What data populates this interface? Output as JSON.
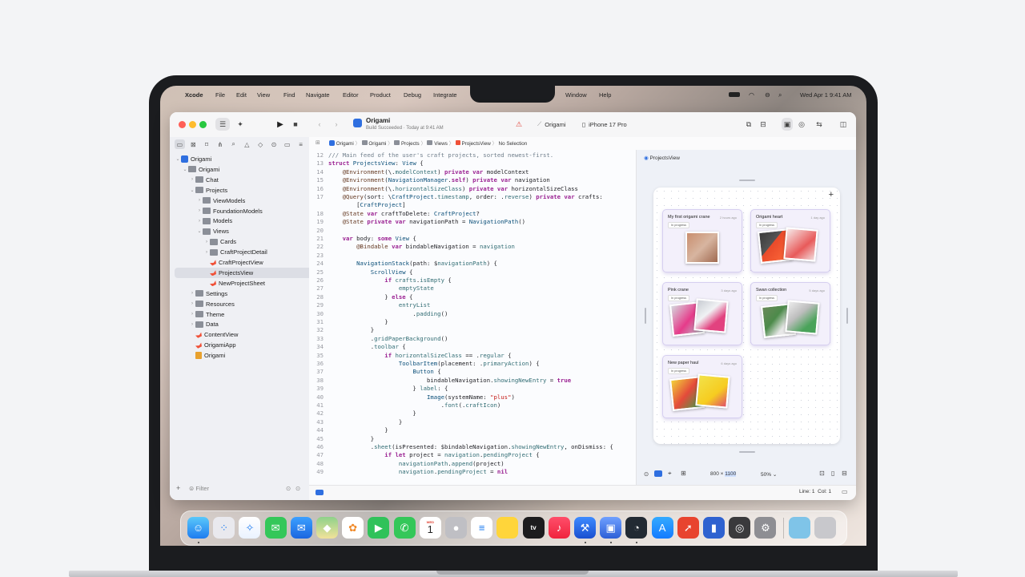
{
  "menubar": {
    "items": [
      "Xcode",
      "File",
      "Edit",
      "View",
      "Find",
      "Navigate",
      "Editor",
      "Product",
      "Debug",
      "Integrate",
      "Window",
      "Help"
    ],
    "clock": "Wed Apr 1  9:41 AM"
  },
  "toolbar": {
    "project_name": "Origami",
    "build_status": "Build Succeeded · Today at 9:41 AM",
    "scheme": "Origami",
    "destination": "iPhone 17 Pro"
  },
  "jumpbar": {
    "path": [
      "Origami",
      "Origami",
      "Projects",
      "Views",
      "ProjectsView",
      "No Selection"
    ]
  },
  "navigator": {
    "items": [
      {
        "label": "Origami",
        "type": "project",
        "indent": 0,
        "chevron": "down"
      },
      {
        "label": "Origami",
        "type": "folder",
        "indent": 1,
        "chevron": "down"
      },
      {
        "label": "Chat",
        "type": "folder",
        "indent": 2,
        "chevron": "right"
      },
      {
        "label": "Projects",
        "type": "folder",
        "indent": 2,
        "chevron": "down"
      },
      {
        "label": "ViewModels",
        "type": "folder",
        "indent": 3,
        "chevron": "right"
      },
      {
        "label": "FoundationModels",
        "type": "folder",
        "indent": 3,
        "chevron": "right"
      },
      {
        "label": "Models",
        "type": "folder",
        "indent": 3,
        "chevron": "right"
      },
      {
        "label": "Views",
        "type": "folder",
        "indent": 3,
        "chevron": "down"
      },
      {
        "label": "Cards",
        "type": "folder",
        "indent": 4,
        "chevron": "right"
      },
      {
        "label": "CraftProjectDetail",
        "type": "folder",
        "indent": 4,
        "chevron": "right"
      },
      {
        "label": "CraftProjectView",
        "type": "swift",
        "indent": 4,
        "chevron": ""
      },
      {
        "label": "ProjectsView",
        "type": "swift",
        "indent": 4,
        "chevron": "",
        "selected": true
      },
      {
        "label": "NewProjectSheet",
        "type": "swift",
        "indent": 4,
        "chevron": ""
      },
      {
        "label": "Settings",
        "type": "folder",
        "indent": 2,
        "chevron": "right"
      },
      {
        "label": "Resources",
        "type": "folder",
        "indent": 2,
        "chevron": "right"
      },
      {
        "label": "Theme",
        "type": "folder",
        "indent": 2,
        "chevron": "right"
      },
      {
        "label": "Data",
        "type": "folder",
        "indent": 2,
        "chevron": "right"
      },
      {
        "label": "ContentView",
        "type": "swift",
        "indent": 2,
        "chevron": ""
      },
      {
        "label": "OrigamiApp",
        "type": "swift",
        "indent": 2,
        "chevron": ""
      },
      {
        "label": "Origami",
        "type": "asset",
        "indent": 2,
        "chevron": ""
      }
    ],
    "filter_placeholder": "Filter"
  },
  "code": {
    "lines": [
      {
        "n": "12",
        "parts": [
          [
            "cm",
            "/// Main feed of the user's craft projects, sorted newest-first."
          ]
        ]
      },
      {
        "n": "13",
        "parts": [
          [
            "kw",
            "struct "
          ],
          [
            "ty",
            "ProjectsView"
          ],
          [
            "pl",
            ": "
          ],
          [
            "ty",
            "View"
          ],
          [
            "pl",
            " {"
          ]
        ]
      },
      {
        "n": "14",
        "parts": [
          [
            "pl",
            "    "
          ],
          [
            "pr",
            "@Environment"
          ],
          [
            "pl",
            "(\\."
          ],
          [
            "fn",
            "modelContext"
          ],
          [
            "pl",
            ") "
          ],
          [
            "kw",
            "private var "
          ],
          [
            "pl",
            "modelContext"
          ]
        ]
      },
      {
        "n": "15",
        "parts": [
          [
            "pl",
            "    "
          ],
          [
            "pr",
            "@Environment"
          ],
          [
            "pl",
            "("
          ],
          [
            "ty",
            "NavigationManager"
          ],
          [
            "pl",
            "."
          ],
          [
            "kw",
            "self"
          ],
          [
            "pl",
            ") "
          ],
          [
            "kw",
            "private var "
          ],
          [
            "pl",
            "navigation"
          ]
        ]
      },
      {
        "n": "16",
        "parts": [
          [
            "pl",
            "    "
          ],
          [
            "pr",
            "@Environment"
          ],
          [
            "pl",
            "(\\."
          ],
          [
            "fn",
            "horizontalSizeClass"
          ],
          [
            "pl",
            ") "
          ],
          [
            "kw",
            "private var "
          ],
          [
            "pl",
            "horizontalSizeClass"
          ]
        ]
      },
      {
        "n": "17",
        "parts": [
          [
            "pl",
            "    "
          ],
          [
            "pr",
            "@Query"
          ],
          [
            "pl",
            "(sort: \\"
          ],
          [
            "ty",
            "CraftProject"
          ],
          [
            "pl",
            "."
          ],
          [
            "fn",
            "timestamp"
          ],
          [
            "pl",
            ", order: ."
          ],
          [
            "fn",
            "reverse"
          ],
          [
            "pl",
            ") "
          ],
          [
            "kw",
            "private var "
          ],
          [
            "pl",
            "crafts:"
          ]
        ]
      },
      {
        "n": "",
        "parts": [
          [
            "pl",
            "        ["
          ],
          [
            "ty",
            "CraftProject"
          ],
          [
            "pl",
            "]"
          ]
        ]
      },
      {
        "n": "18",
        "parts": [
          [
            "pl",
            "    "
          ],
          [
            "pr",
            "@State "
          ],
          [
            "kw",
            "var "
          ],
          [
            "pl",
            "craftToDelete: "
          ],
          [
            "ty",
            "CraftProject"
          ],
          [
            "pl",
            "?"
          ]
        ]
      },
      {
        "n": "19",
        "parts": [
          [
            "pl",
            "    "
          ],
          [
            "pr",
            "@State "
          ],
          [
            "kw",
            "private var "
          ],
          [
            "pl",
            "navigationPath = "
          ],
          [
            "ty",
            "NavigationPath"
          ],
          [
            "pl",
            "()"
          ]
        ]
      },
      {
        "n": "20",
        "parts": [
          [
            "pl",
            ""
          ]
        ]
      },
      {
        "n": "21",
        "parts": [
          [
            "pl",
            "    "
          ],
          [
            "kw",
            "var "
          ],
          [
            "pl",
            "body: "
          ],
          [
            "kw",
            "some "
          ],
          [
            "ty",
            "View"
          ],
          [
            "pl",
            " {"
          ]
        ]
      },
      {
        "n": "22",
        "parts": [
          [
            "pl",
            "        "
          ],
          [
            "pr",
            "@Bindable "
          ],
          [
            "kw",
            "var "
          ],
          [
            "pl",
            "bindableNavigation = "
          ],
          [
            "fn",
            "navigation"
          ]
        ]
      },
      {
        "n": "23",
        "parts": [
          [
            "pl",
            ""
          ]
        ]
      },
      {
        "n": "24",
        "parts": [
          [
            "pl",
            "        "
          ],
          [
            "ty",
            "NavigationStack"
          ],
          [
            "pl",
            "(path: $"
          ],
          [
            "fn",
            "navigationPath"
          ],
          [
            "pl",
            ") {"
          ]
        ]
      },
      {
        "n": "25",
        "parts": [
          [
            "pl",
            "            "
          ],
          [
            "ty",
            "ScrollView"
          ],
          [
            "pl",
            " {"
          ]
        ]
      },
      {
        "n": "26",
        "parts": [
          [
            "pl",
            "                "
          ],
          [
            "kw",
            "if "
          ],
          [
            "fn",
            "crafts"
          ],
          [
            "pl",
            "."
          ],
          [
            "fn",
            "isEmpty"
          ],
          [
            "pl",
            " {"
          ]
        ]
      },
      {
        "n": "27",
        "parts": [
          [
            "pl",
            "                    "
          ],
          [
            "fn",
            "emptyState"
          ]
        ]
      },
      {
        "n": "28",
        "parts": [
          [
            "pl",
            "                } "
          ],
          [
            "kw",
            "else "
          ],
          [
            "pl",
            "{"
          ]
        ]
      },
      {
        "n": "29",
        "parts": [
          [
            "pl",
            "                    "
          ],
          [
            "fn",
            "entryList"
          ]
        ]
      },
      {
        "n": "30",
        "parts": [
          [
            "pl",
            "                        ."
          ],
          [
            "fn",
            "padding"
          ],
          [
            "pl",
            "()"
          ]
        ]
      },
      {
        "n": "31",
        "parts": [
          [
            "pl",
            "                }"
          ]
        ]
      },
      {
        "n": "32",
        "parts": [
          [
            "pl",
            "            }"
          ]
        ]
      },
      {
        "n": "33",
        "parts": [
          [
            "pl",
            "            ."
          ],
          [
            "fn",
            "gridPaperBackground"
          ],
          [
            "pl",
            "()"
          ]
        ]
      },
      {
        "n": "34",
        "parts": [
          [
            "pl",
            "            ."
          ],
          [
            "fn",
            "toolbar"
          ],
          [
            "pl",
            " {"
          ]
        ]
      },
      {
        "n": "35",
        "parts": [
          [
            "pl",
            "                "
          ],
          [
            "kw",
            "if "
          ],
          [
            "fn",
            "horizontalSizeClass"
          ],
          [
            "pl",
            " == ."
          ],
          [
            "fn",
            "regular"
          ],
          [
            "pl",
            " {"
          ]
        ]
      },
      {
        "n": "36",
        "parts": [
          [
            "pl",
            "                    "
          ],
          [
            "ty",
            "ToolbarItem"
          ],
          [
            "pl",
            "(placement: ."
          ],
          [
            "fn",
            "primaryAction"
          ],
          [
            "pl",
            ") {"
          ]
        ]
      },
      {
        "n": "37",
        "parts": [
          [
            "pl",
            "                        "
          ],
          [
            "ty",
            "Button"
          ],
          [
            "pl",
            " {"
          ]
        ]
      },
      {
        "n": "38",
        "parts": [
          [
            "pl",
            "                            "
          ],
          [
            "pl",
            "bindableNavigation."
          ],
          [
            "fn",
            "showingNewEntry"
          ],
          [
            "pl",
            " = "
          ],
          [
            "kw",
            "true"
          ]
        ]
      },
      {
        "n": "39",
        "parts": [
          [
            "pl",
            "                        } "
          ],
          [
            "fn",
            "label"
          ],
          [
            "pl",
            ": {"
          ]
        ]
      },
      {
        "n": "40",
        "parts": [
          [
            "pl",
            "                            "
          ],
          [
            "ty",
            "Image"
          ],
          [
            "pl",
            "(systemName: "
          ],
          [
            "str",
            "\"plus\""
          ],
          [
            "pl",
            ")"
          ]
        ]
      },
      {
        "n": "41",
        "parts": [
          [
            "pl",
            "                                ."
          ],
          [
            "fn",
            "font"
          ],
          [
            "pl",
            "(."
          ],
          [
            "fn",
            "craftIcon"
          ],
          [
            "pl",
            ")"
          ]
        ]
      },
      {
        "n": "42",
        "parts": [
          [
            "pl",
            "                        }"
          ]
        ]
      },
      {
        "n": "43",
        "parts": [
          [
            "pl",
            "                    }"
          ]
        ]
      },
      {
        "n": "44",
        "parts": [
          [
            "pl",
            "                }"
          ]
        ]
      },
      {
        "n": "45",
        "parts": [
          [
            "pl",
            "            }"
          ]
        ]
      },
      {
        "n": "46",
        "parts": [
          [
            "pl",
            "            ."
          ],
          [
            "fn",
            "sheet"
          ],
          [
            "pl",
            "(isPresented: $bindableNavigation."
          ],
          [
            "fn",
            "showingNewEntry"
          ],
          [
            "pl",
            ", onDismiss: {"
          ]
        ]
      },
      {
        "n": "47",
        "parts": [
          [
            "pl",
            "                "
          ],
          [
            "kw",
            "if let "
          ],
          [
            "pl",
            "project = "
          ],
          [
            "fn",
            "navigation"
          ],
          [
            "pl",
            "."
          ],
          [
            "fn",
            "pendingProject"
          ],
          [
            "pl",
            " {"
          ]
        ]
      },
      {
        "n": "48",
        "parts": [
          [
            "pl",
            "                    "
          ],
          [
            "fn",
            "navigationPath"
          ],
          [
            "pl",
            "."
          ],
          [
            "fn",
            "append"
          ],
          [
            "pl",
            "(project)"
          ]
        ]
      },
      {
        "n": "49",
        "parts": [
          [
            "pl",
            "                    "
          ],
          [
            "fn",
            "navigation"
          ],
          [
            "pl",
            "."
          ],
          [
            "fn",
            "pendingProject"
          ],
          [
            "pl",
            " = "
          ],
          [
            "kw",
            "nil"
          ]
        ]
      }
    ]
  },
  "preview": {
    "label": "ProjectsView",
    "size_w": "800",
    "size_x": "×",
    "size_h": "1100",
    "zoom": "50%",
    "cards": [
      {
        "title": "My first origami crane",
        "date": "2 hours ago",
        "badge": "In progress"
      },
      {
        "title": "Origami heart",
        "date": "1 day ago",
        "badge": "In progress"
      },
      {
        "title": "Pink crane",
        "date": "3 days ago",
        "badge": "In progress"
      },
      {
        "title": "Swan collection",
        "date": "5 days ago",
        "badge": "In progress"
      },
      {
        "title": "New paper haul",
        "date": "6 days ago",
        "badge": "In progress"
      }
    ]
  },
  "status": {
    "cursor": "Line: 1  Col: 1"
  },
  "dock": {
    "icons": [
      "finder-icon",
      "launchpad-icon",
      "safari-icon",
      "messages-icon",
      "mail-icon",
      "maps-icon",
      "photos-icon",
      "facetime-icon",
      "phone-icon",
      "calendar-icon",
      "contacts-icon",
      "reminders-icon",
      "notes-icon",
      "tv-icon",
      "music-icon",
      "xcode-icon",
      "simulator-icon",
      "instruments-icon",
      "app-store-icon",
      "rocket-icon",
      "files-icon",
      "accessibility-icon",
      "settings-icon",
      "downloads-icon",
      "trash-icon"
    ],
    "calendar_month": "WED",
    "calendar_day": "1",
    "tv_label": "tv"
  }
}
